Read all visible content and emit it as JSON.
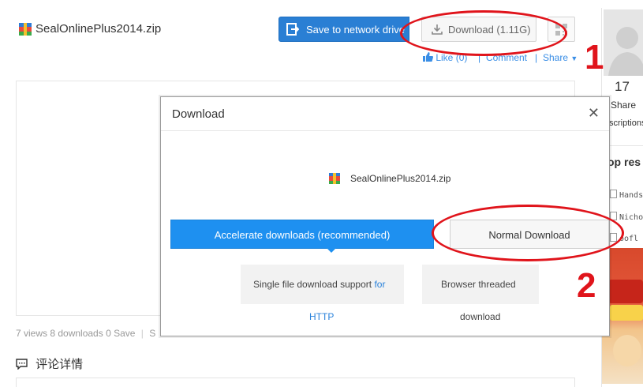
{
  "file": {
    "name": "SealOnlinePlus2014.zip"
  },
  "toolbar": {
    "save_label": "Save to network drive",
    "download_label": "Download (1.11G)",
    "like_label": "Like (0)",
    "comment_label": "Comment",
    "share_label": "Share"
  },
  "stats": {
    "text": "7 views 8 downloads 0 Save",
    "extra": "S"
  },
  "comments": {
    "title": "评论详情"
  },
  "sidebar": {
    "count": "17",
    "share": "Share",
    "scriptions": "scriptions",
    "top_resources": "op res",
    "items": [
      "Hands",
      "Nicho",
      "oofl"
    ]
  },
  "dialog": {
    "title": "Download",
    "file_name": "SealOnlinePlus2014.zip",
    "accelerate_label": "Accelerate downloads (recommended)",
    "normal_label": "Normal Download",
    "info1_line1": "Single file download support",
    "info1_link": "for",
    "info1_line2": "HTTP",
    "info2_line1": "Browser threaded",
    "info2_line2": "download"
  },
  "annotations": {
    "marker1": "1",
    "marker2": "2"
  },
  "colors": {
    "accent": "#1e90f0",
    "save_button": "#2a7fd4",
    "annotation": "#e0141b",
    "link": "#2b83db"
  },
  "icons": [
    "zip-file-icon",
    "save-to-drive-icon",
    "download-icon",
    "qr-code-icon",
    "thumbs-up-icon",
    "chevron-down-icon",
    "close-icon",
    "comment-icon",
    "avatar-placeholder-icon",
    "document-icon"
  ]
}
